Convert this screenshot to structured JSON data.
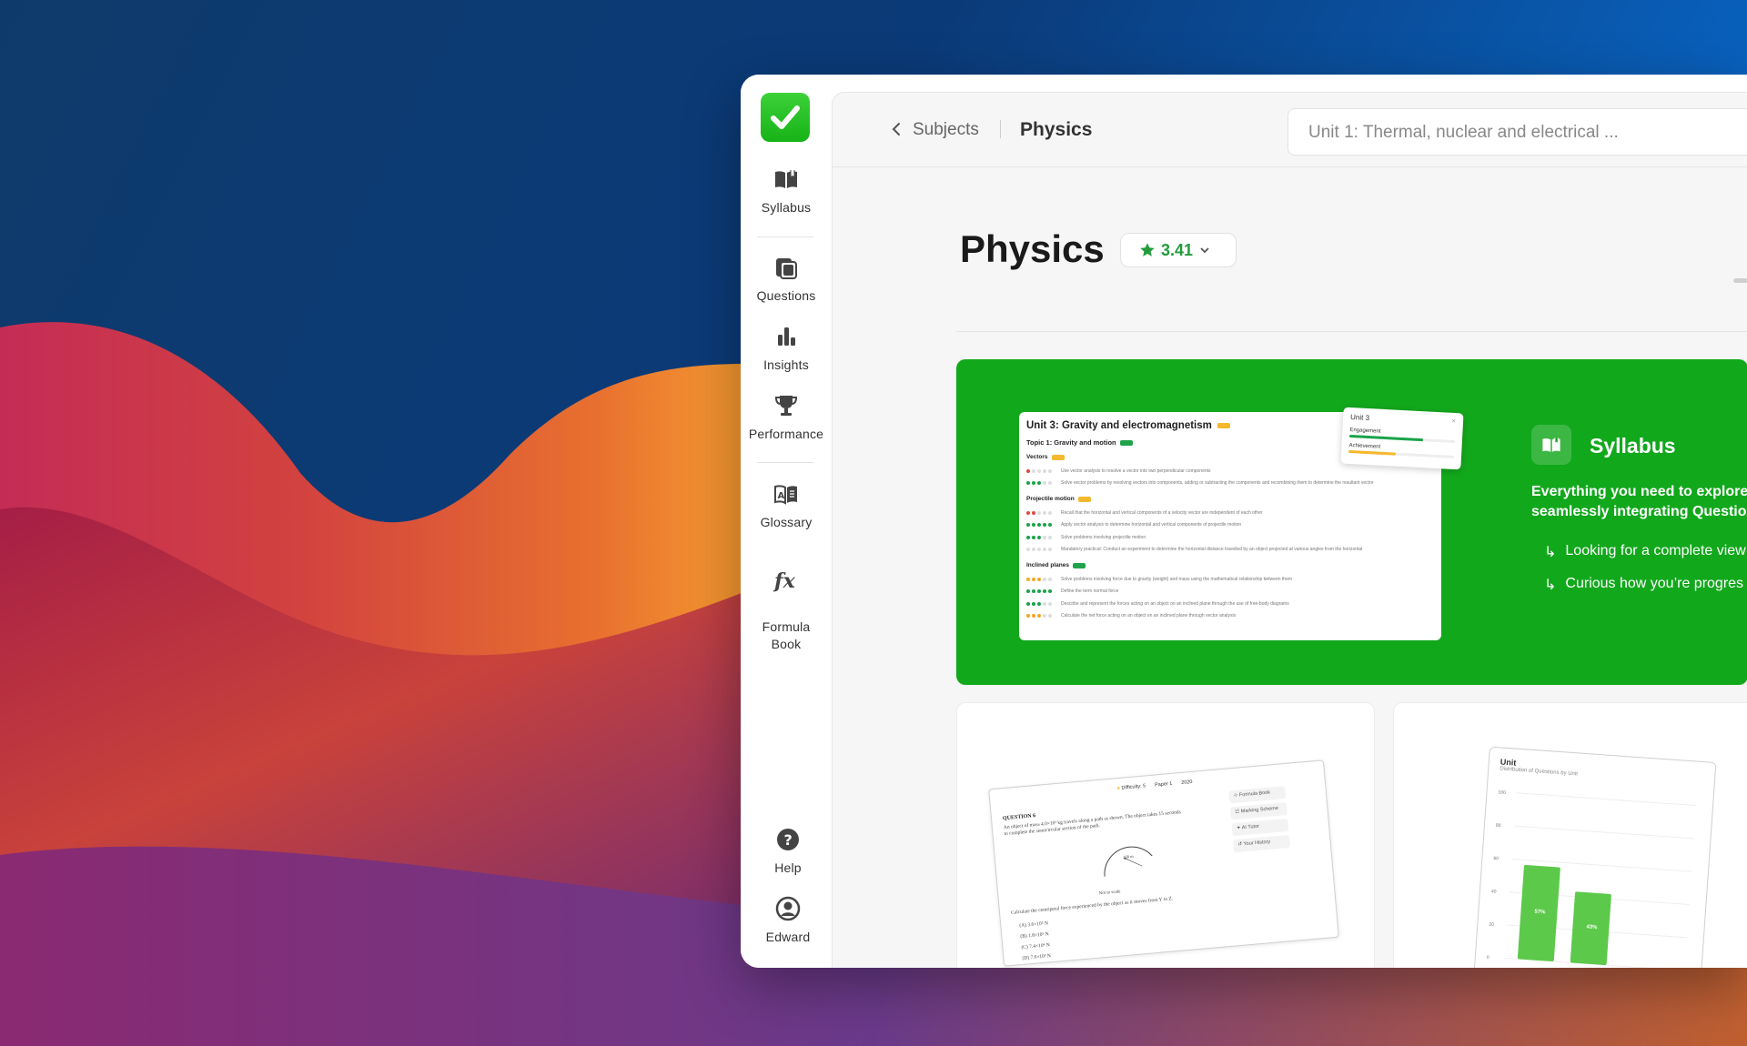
{
  "sidebar": {
    "items": [
      {
        "label": "Syllabus",
        "icon": "book-open-icon"
      },
      {
        "label": "Questions",
        "icon": "cards-icon"
      },
      {
        "label": "Insights",
        "icon": "bar-chart-icon"
      },
      {
        "label": "Performance",
        "icon": "trophy-icon"
      },
      {
        "label": "Glossary",
        "icon": "glossary-icon"
      },
      {
        "label": "Formula\nBook",
        "icon": "formula-fx-icon"
      }
    ],
    "help_label": "Help",
    "user_label": "Edward"
  },
  "topbar": {
    "breadcrumb_parent": "Subjects",
    "breadcrumb_current": "Physics",
    "unit_select_value": "Unit 1: Thermal, nuclear and electrical ..."
  },
  "header": {
    "title": "Physics",
    "rating": "3.41"
  },
  "hero": {
    "mini_title": "Unit 3: Gravity and electromagnetism",
    "mini_topic": "Topic 1: Gravity and motion",
    "sections": [
      {
        "name": "Vectors",
        "chip": "y",
        "rows": [
          {
            "dots": "r....",
            "text": "Use vector analysis to resolve a vector into two perpendicular components"
          },
          {
            "dots": "ggg..",
            "text": "Solve vector problems by resolving vectors into components, adding or subtracting the components and recombining them to determine the resultant vector"
          }
        ]
      },
      {
        "name": "Projectile motion",
        "chip": "y",
        "rows": [
          {
            "dots": "rr...",
            "text": "Recall that the horizontal and vertical components of a velocity vector are independent of each other"
          },
          {
            "dots": "ggggg",
            "text": "Apply vector analysis to determine horizontal and vertical components of projectile motion"
          },
          {
            "dots": "ggg..",
            "text": "Solve problems involving projectile motion"
          },
          {
            "dots": ".....",
            "text": "Mandatory practical: Conduct an experiment to determine the horizontal distance travelled by an object projected at various angles from the horizontal"
          }
        ]
      },
      {
        "name": "Inclined planes",
        "chip": "g",
        "rows": [
          {
            "dots": "ooo..",
            "text": "Solve problems involving force due to gravity (weight) and mass using the mathematical relationship between them"
          },
          {
            "dots": "ggggg",
            "text": "Define the term normal force"
          },
          {
            "dots": "ggg..",
            "text": "Describe and represent the forces acting on an object on an inclined plane through the use of free-body diagrams"
          },
          {
            "dots": "ooo..",
            "text": "Calculate the net force acting on an object on an inclined plane through vector analysis"
          }
        ]
      }
    ],
    "popup": {
      "title": "Unit 3",
      "engagement": "Engagement",
      "achievement": "Achievement",
      "engagement_pct": 0.7,
      "achievement_pct": 0.45
    },
    "card_title": "Syllabus",
    "desc_line1": "Everything you need to explore, t",
    "desc_line2": "seamlessly integrating Question",
    "bullet1": "Looking for a complete view",
    "bullet2": "Curious how you’re progres"
  },
  "questions_card": {
    "difficulty": "Difficulty: 5",
    "paper": "Paper 1",
    "year": "2020",
    "question_label": "QUESTION 6",
    "question_text": "An object of mass 4.0×10³ kg travels along a path as shown. The object takes 15 seconds to complete the semicircular section of the path.",
    "not_to_scale": "Not to scale",
    "calc_text": "Calculate the centripetal force experienced by the object as it moves from Y to Z.",
    "options": [
      "(A)  3.6×10⁵ N",
      "(B)  1.8×10⁵ N",
      "(C)  7.4×10⁴ N",
      "(D)  7.6×10³ N"
    ],
    "menu": [
      "Formula Book",
      "Marking Scheme",
      "AI Tutor",
      "Your History"
    ],
    "radius_label": "200 m"
  },
  "insights_card": {
    "title": "Unit",
    "subtitle": "Distribution of Questions by Unit",
    "y_ticks": [
      "100",
      "80",
      "60",
      "40",
      "20",
      "0"
    ]
  },
  "chart_data": {
    "type": "bar",
    "title": "Unit",
    "subtitle": "Distribution of Questions by Unit",
    "categories": [
      "",
      ""
    ],
    "values": [
      57,
      43
    ],
    "data_labels": [
      "57%",
      "43%"
    ],
    "ylim": [
      0,
      100
    ],
    "color": "#5cc94a"
  },
  "colors": {
    "brand_green": "#12a81c",
    "accent_green": "#239c3b"
  }
}
